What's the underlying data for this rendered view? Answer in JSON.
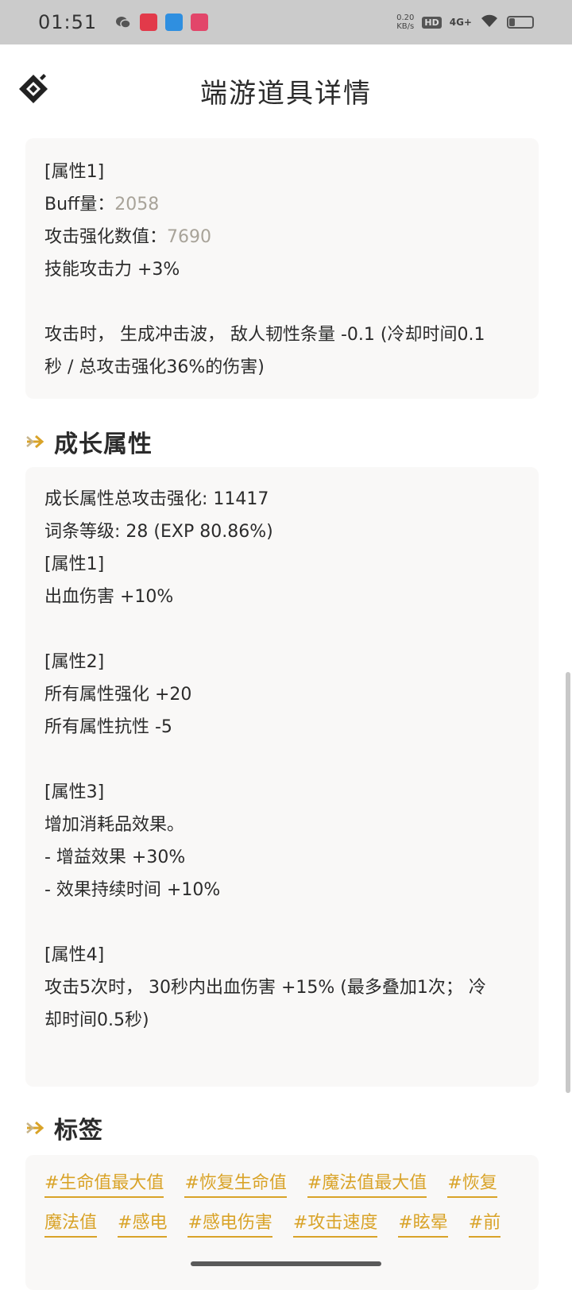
{
  "status_bar": {
    "time": "01:51",
    "net_speed": "0.20",
    "net_unit": "KB/s",
    "hd": "HD",
    "signal": "4G+",
    "battery_level": 0.25
  },
  "header": {
    "title": "端游道具详情"
  },
  "attributes_card": {
    "lines": [
      {
        "label": "[属性1]",
        "value": ""
      },
      {
        "label": "Buff量：",
        "value": "2058"
      },
      {
        "label": "攻击强化数值：",
        "value": "7690"
      },
      {
        "label": "技能攻击力 +3%",
        "value": ""
      },
      {
        "label": "",
        "value": ""
      },
      {
        "label": "攻击时， 生成冲击波， 敌人韧性条量 -0.1 (冷却时间0.1",
        "value": ""
      },
      {
        "label": "秒 / 总攻击强化36%的伤害)",
        "value": ""
      }
    ]
  },
  "growth_section": {
    "title": "成长属性",
    "lines": [
      "成长属性总攻击强化: 11417",
      "词条等级: 28 (EXP 80.86%)",
      "[属性1]",
      "出血伤害 +10%",
      "",
      "[属性2]",
      "所有属性强化 +20",
      "所有属性抗性 -5",
      "",
      "[属性3]",
      "增加消耗品效果。",
      "- 增益效果 +30%",
      "- 效果持续时间 +10%",
      "",
      "[属性4]",
      "攻击5次时， 30秒内出血伤害 +15% (最多叠加1次； 冷",
      "却时间0.5秒)"
    ]
  },
  "tags_section": {
    "title": "标签",
    "rows": [
      [
        "#生命值最大值",
        "#恢复生命值",
        "#魔法值最大值",
        "#恢复"
      ],
      [
        "魔法值",
        "#感电",
        "#感电伤害",
        "#攻击速度",
        "#眩晕",
        "#前"
      ]
    ]
  },
  "colors": {
    "accent": "#d9a328",
    "dim_value": "#a8a399",
    "card_bg": "#f9f8f7"
  }
}
